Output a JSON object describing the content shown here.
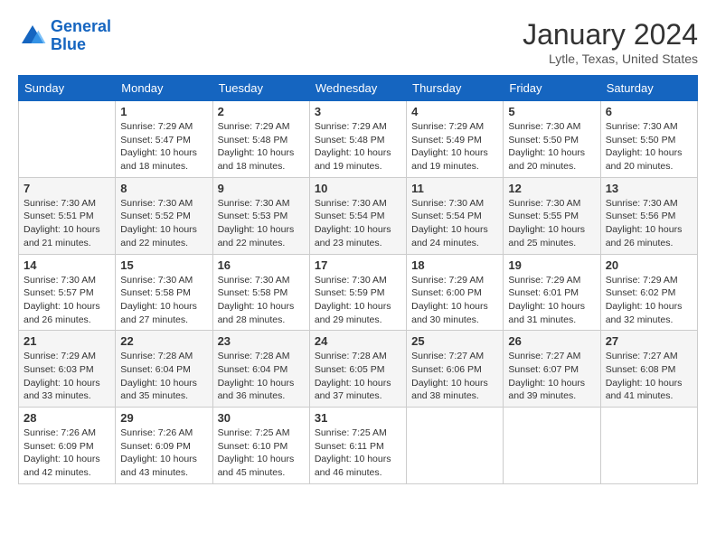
{
  "header": {
    "logo_line1": "General",
    "logo_line2": "Blue",
    "month": "January 2024",
    "location": "Lytle, Texas, United States"
  },
  "weekdays": [
    "Sunday",
    "Monday",
    "Tuesday",
    "Wednesday",
    "Thursday",
    "Friday",
    "Saturday"
  ],
  "weeks": [
    [
      {
        "day": "",
        "sunrise": "",
        "sunset": "",
        "daylight": ""
      },
      {
        "day": "1",
        "sunrise": "Sunrise: 7:29 AM",
        "sunset": "Sunset: 5:47 PM",
        "daylight": "Daylight: 10 hours and 18 minutes."
      },
      {
        "day": "2",
        "sunrise": "Sunrise: 7:29 AM",
        "sunset": "Sunset: 5:48 PM",
        "daylight": "Daylight: 10 hours and 18 minutes."
      },
      {
        "day": "3",
        "sunrise": "Sunrise: 7:29 AM",
        "sunset": "Sunset: 5:48 PM",
        "daylight": "Daylight: 10 hours and 19 minutes."
      },
      {
        "day": "4",
        "sunrise": "Sunrise: 7:29 AM",
        "sunset": "Sunset: 5:49 PM",
        "daylight": "Daylight: 10 hours and 19 minutes."
      },
      {
        "day": "5",
        "sunrise": "Sunrise: 7:30 AM",
        "sunset": "Sunset: 5:50 PM",
        "daylight": "Daylight: 10 hours and 20 minutes."
      },
      {
        "day": "6",
        "sunrise": "Sunrise: 7:30 AM",
        "sunset": "Sunset: 5:50 PM",
        "daylight": "Daylight: 10 hours and 20 minutes."
      }
    ],
    [
      {
        "day": "7",
        "sunrise": "Sunrise: 7:30 AM",
        "sunset": "Sunset: 5:51 PM",
        "daylight": "Daylight: 10 hours and 21 minutes."
      },
      {
        "day": "8",
        "sunrise": "Sunrise: 7:30 AM",
        "sunset": "Sunset: 5:52 PM",
        "daylight": "Daylight: 10 hours and 22 minutes."
      },
      {
        "day": "9",
        "sunrise": "Sunrise: 7:30 AM",
        "sunset": "Sunset: 5:53 PM",
        "daylight": "Daylight: 10 hours and 22 minutes."
      },
      {
        "day": "10",
        "sunrise": "Sunrise: 7:30 AM",
        "sunset": "Sunset: 5:54 PM",
        "daylight": "Daylight: 10 hours and 23 minutes."
      },
      {
        "day": "11",
        "sunrise": "Sunrise: 7:30 AM",
        "sunset": "Sunset: 5:54 PM",
        "daylight": "Daylight: 10 hours and 24 minutes."
      },
      {
        "day": "12",
        "sunrise": "Sunrise: 7:30 AM",
        "sunset": "Sunset: 5:55 PM",
        "daylight": "Daylight: 10 hours and 25 minutes."
      },
      {
        "day": "13",
        "sunrise": "Sunrise: 7:30 AM",
        "sunset": "Sunset: 5:56 PM",
        "daylight": "Daylight: 10 hours and 26 minutes."
      }
    ],
    [
      {
        "day": "14",
        "sunrise": "Sunrise: 7:30 AM",
        "sunset": "Sunset: 5:57 PM",
        "daylight": "Daylight: 10 hours and 26 minutes."
      },
      {
        "day": "15",
        "sunrise": "Sunrise: 7:30 AM",
        "sunset": "Sunset: 5:58 PM",
        "daylight": "Daylight: 10 hours and 27 minutes."
      },
      {
        "day": "16",
        "sunrise": "Sunrise: 7:30 AM",
        "sunset": "Sunset: 5:58 PM",
        "daylight": "Daylight: 10 hours and 28 minutes."
      },
      {
        "day": "17",
        "sunrise": "Sunrise: 7:30 AM",
        "sunset": "Sunset: 5:59 PM",
        "daylight": "Daylight: 10 hours and 29 minutes."
      },
      {
        "day": "18",
        "sunrise": "Sunrise: 7:29 AM",
        "sunset": "Sunset: 6:00 PM",
        "daylight": "Daylight: 10 hours and 30 minutes."
      },
      {
        "day": "19",
        "sunrise": "Sunrise: 7:29 AM",
        "sunset": "Sunset: 6:01 PM",
        "daylight": "Daylight: 10 hours and 31 minutes."
      },
      {
        "day": "20",
        "sunrise": "Sunrise: 7:29 AM",
        "sunset": "Sunset: 6:02 PM",
        "daylight": "Daylight: 10 hours and 32 minutes."
      }
    ],
    [
      {
        "day": "21",
        "sunrise": "Sunrise: 7:29 AM",
        "sunset": "Sunset: 6:03 PM",
        "daylight": "Daylight: 10 hours and 33 minutes."
      },
      {
        "day": "22",
        "sunrise": "Sunrise: 7:28 AM",
        "sunset": "Sunset: 6:04 PM",
        "daylight": "Daylight: 10 hours and 35 minutes."
      },
      {
        "day": "23",
        "sunrise": "Sunrise: 7:28 AM",
        "sunset": "Sunset: 6:04 PM",
        "daylight": "Daylight: 10 hours and 36 minutes."
      },
      {
        "day": "24",
        "sunrise": "Sunrise: 7:28 AM",
        "sunset": "Sunset: 6:05 PM",
        "daylight": "Daylight: 10 hours and 37 minutes."
      },
      {
        "day": "25",
        "sunrise": "Sunrise: 7:27 AM",
        "sunset": "Sunset: 6:06 PM",
        "daylight": "Daylight: 10 hours and 38 minutes."
      },
      {
        "day": "26",
        "sunrise": "Sunrise: 7:27 AM",
        "sunset": "Sunset: 6:07 PM",
        "daylight": "Daylight: 10 hours and 39 minutes."
      },
      {
        "day": "27",
        "sunrise": "Sunrise: 7:27 AM",
        "sunset": "Sunset: 6:08 PM",
        "daylight": "Daylight: 10 hours and 41 minutes."
      }
    ],
    [
      {
        "day": "28",
        "sunrise": "Sunrise: 7:26 AM",
        "sunset": "Sunset: 6:09 PM",
        "daylight": "Daylight: 10 hours and 42 minutes."
      },
      {
        "day": "29",
        "sunrise": "Sunrise: 7:26 AM",
        "sunset": "Sunset: 6:09 PM",
        "daylight": "Daylight: 10 hours and 43 minutes."
      },
      {
        "day": "30",
        "sunrise": "Sunrise: 7:25 AM",
        "sunset": "Sunset: 6:10 PM",
        "daylight": "Daylight: 10 hours and 45 minutes."
      },
      {
        "day": "31",
        "sunrise": "Sunrise: 7:25 AM",
        "sunset": "Sunset: 6:11 PM",
        "daylight": "Daylight: 10 hours and 46 minutes."
      },
      {
        "day": "",
        "sunrise": "",
        "sunset": "",
        "daylight": ""
      },
      {
        "day": "",
        "sunrise": "",
        "sunset": "",
        "daylight": ""
      },
      {
        "day": "",
        "sunrise": "",
        "sunset": "",
        "daylight": ""
      }
    ]
  ]
}
